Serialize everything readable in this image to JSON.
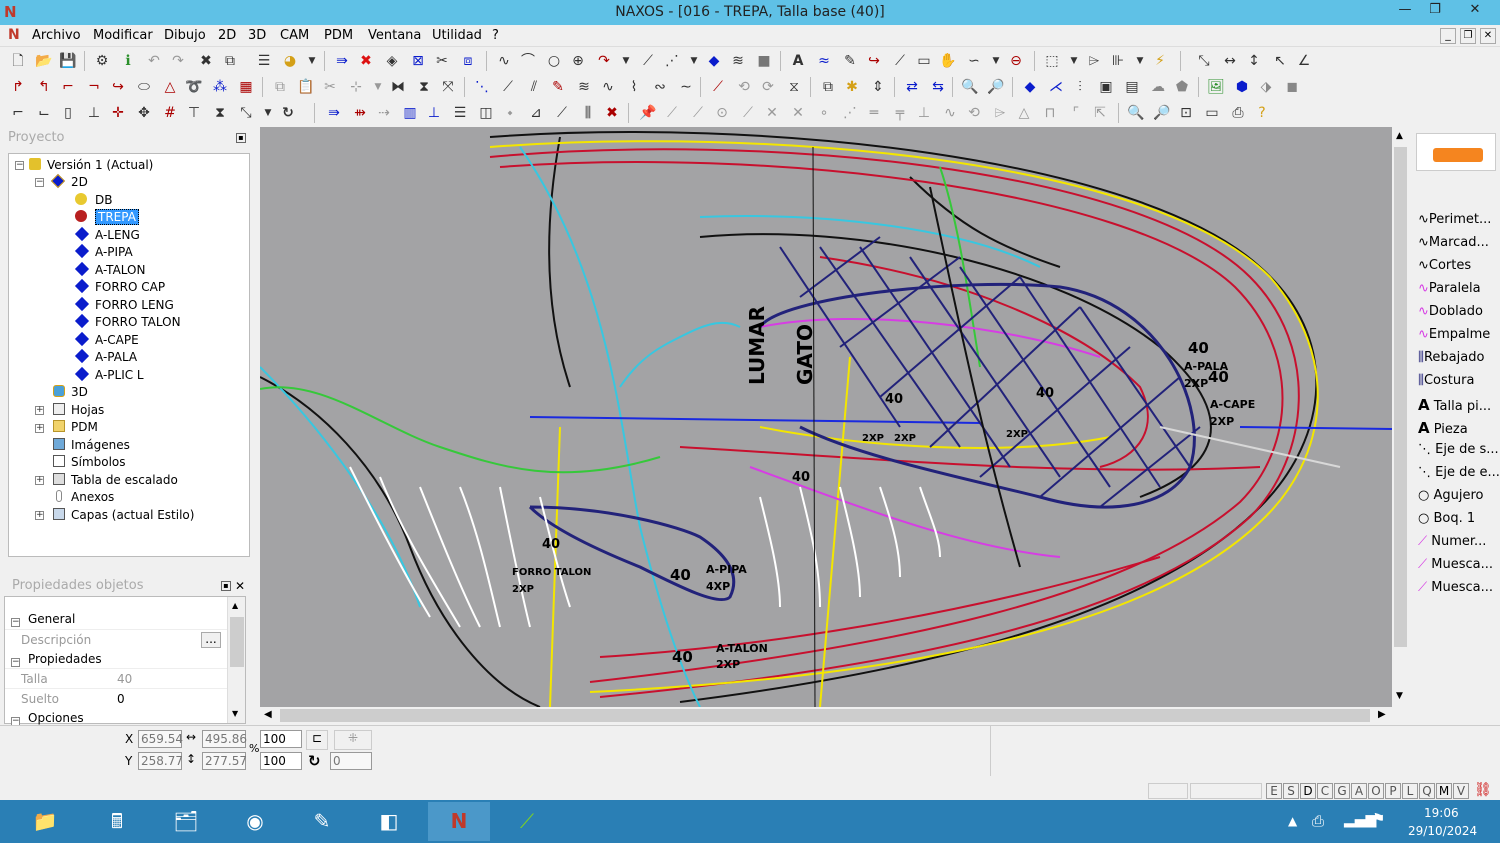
{
  "window": {
    "title": "NAXOS - [016 - TREPA, Talla base (40)]",
    "logo_letter": "N",
    "minimize": "—",
    "restore": "❐",
    "close": "✕"
  },
  "menu": [
    "Archivo",
    "Modificar",
    "Dibujo",
    "2D",
    "3D",
    "CAM",
    "PDM",
    "Ventana",
    "Utilidad",
    "?"
  ],
  "mdi_buttons": [
    "_",
    "❐",
    "✕"
  ],
  "project_panel": {
    "header": "Proyecto",
    "tree": [
      {
        "label": "Versión 1 (Actual)",
        "icon": "version-icon"
      },
      {
        "label": "2D",
        "icon": "diamond-2d-icon"
      },
      {
        "label": "DB",
        "icon": "yellow-dot-icon"
      },
      {
        "label": "TREPA",
        "icon": "red-dot-icon",
        "selected": true
      },
      {
        "label": "A-LENG",
        "icon": "blue-diamond-icon"
      },
      {
        "label": "A-PIPA",
        "icon": "blue-diamond-icon"
      },
      {
        "label": "A-TALON",
        "icon": "blue-diamond-icon"
      },
      {
        "label": "FORRO CAP",
        "icon": "blue-diamond-icon"
      },
      {
        "label": "FORRO LENG",
        "icon": "blue-diamond-icon"
      },
      {
        "label": "FORRO TALON",
        "icon": "blue-diamond-icon"
      },
      {
        "label": "A-CAPE",
        "icon": "blue-diamond-icon"
      },
      {
        "label": "A-PALA",
        "icon": "blue-diamond-icon"
      },
      {
        "label": "A-PLIC L",
        "icon": "blue-diamond-icon"
      },
      {
        "label": "3D",
        "icon": "3d-icon"
      },
      {
        "label": "Hojas",
        "icon": "sheets-icon"
      },
      {
        "label": "PDM",
        "icon": "folder-icon"
      },
      {
        "label": "Imágenes",
        "icon": "images-icon"
      },
      {
        "label": "Símbolos",
        "icon": "symbols-icon"
      },
      {
        "label": "Tabla de escalado",
        "icon": "table-icon"
      },
      {
        "label": "Anexos",
        "icon": "attachment-icon"
      },
      {
        "label": "Capas (actual Estilo)",
        "icon": "layers-icon"
      }
    ]
  },
  "properties_panel": {
    "header": "Propiedades objetos",
    "general": "General",
    "descripcion_label": "Descripción",
    "descripcion_btn": "...",
    "propiedades": "Propiedades",
    "talla_label": "Talla",
    "talla_value": "40",
    "suelto_label": "Suelto",
    "suelto_value": "0",
    "opciones": "Opciones"
  },
  "right_panel": {
    "items": [
      {
        "label": "Perimet...",
        "icon": "curve-icon"
      },
      {
        "label": "Marcad...",
        "icon": "curve-icon"
      },
      {
        "label": "Cortes",
        "icon": "curve-icon"
      },
      {
        "label": "Paralela",
        "icon": "pink-curve-icon"
      },
      {
        "label": "Doblado",
        "icon": "pink-curve-icon"
      },
      {
        "label": "Empalme",
        "icon": "pink-curve-icon"
      },
      {
        "label": "Rebajado",
        "icon": "bars-icon"
      },
      {
        "label": "Costura",
        "icon": "bars-icon"
      },
      {
        "label": "Talla pi...",
        "icon": "letter-a-icon"
      },
      {
        "label": "Pieza",
        "icon": "letter-a-icon"
      },
      {
        "label": "Eje de s...",
        "icon": "dashed-line-icon"
      },
      {
        "label": "Eje de e...",
        "icon": "dashed-line-icon"
      },
      {
        "label": "Agujero",
        "icon": "circle-icon"
      },
      {
        "label": "Boq. 1",
        "icon": "circle-icon"
      },
      {
        "label": "Numer...",
        "icon": "slash-icon"
      },
      {
        "label": "Muesca...",
        "icon": "slash-icon"
      },
      {
        "label": "Muesca...",
        "icon": "slash-icon"
      }
    ]
  },
  "canvas_labels": {
    "a_pala_size": "40",
    "a_pala": "A-PALA",
    "a_pala_qty": "2XP",
    "a_pala_size2": "40",
    "a_cape": "A-CAPE",
    "a_cape_qty": "2XP",
    "lumar": "LUMAR",
    "gato": "GATO",
    "forro_size": "40",
    "forro": "FORRO TALON",
    "forro_qty": "2XP",
    "pipa_size": "40",
    "pipa": "A-PIPA",
    "pipa_qty": "4XP",
    "talon_size": "40",
    "talon": "A-TALON",
    "talon_qty": "2XP",
    "mid_size": "40",
    "mid_size2": "40",
    "mid_qty1": "2XP",
    "mid_qty2": "2XP",
    "mid_qty3": "2XP",
    "left_size": "40",
    "inner_size": "40"
  },
  "status": {
    "x_label": "X",
    "y_label": "Y",
    "x_value": "659.54",
    "y_value": "258.77",
    "w_value": "495.86",
    "h_value": "277.57",
    "pct_label": "%",
    "scale_x": "100",
    "scale_y": "100",
    "rotation": "0",
    "modes": [
      "E",
      "S",
      "D",
      "C",
      "G",
      "A",
      "O",
      "P",
      "L",
      "Q",
      "M",
      "V"
    ]
  },
  "taskbar": {
    "time": "19:06",
    "date": "29/10/2024",
    "apps": [
      "file-explorer-icon",
      "calculator-icon",
      "app-icon",
      "chrome-icon",
      "app2-icon",
      "app3-icon",
      "naxos-icon",
      "app4-icon"
    ]
  }
}
